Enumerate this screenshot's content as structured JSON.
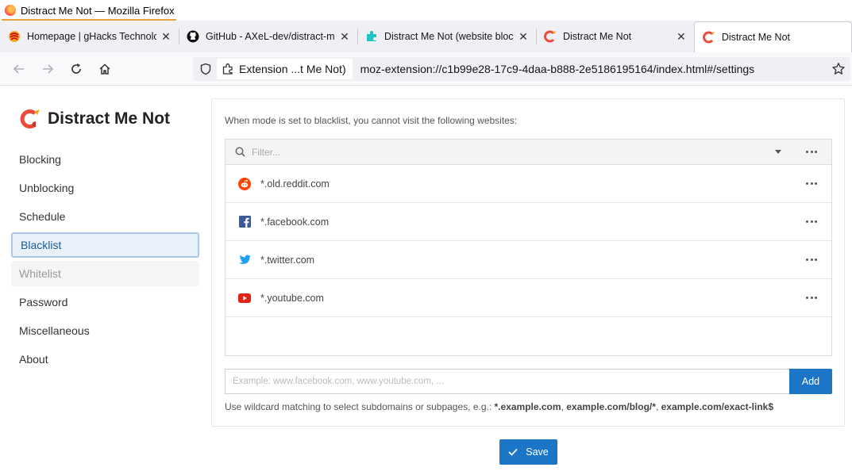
{
  "window": {
    "title": "Distract Me Not — Mozilla Firefox"
  },
  "tabs": [
    {
      "label": "Homepage | gHacks Technolog",
      "icon": "ghacks-icon",
      "active": false
    },
    {
      "label": "GitHub - AXeL-dev/distract-me",
      "icon": "github-icon",
      "active": false
    },
    {
      "label": "Distract Me Not (website blocke",
      "icon": "puzzle-icon",
      "active": false
    },
    {
      "label": "Distract Me Not",
      "icon": "magnet-icon",
      "active": false
    },
    {
      "label": "Distract Me Not",
      "icon": "magnet-icon",
      "active": true
    }
  ],
  "tab_close_glyph": "✕",
  "navbar": {
    "extension_chip": "Extension ...t Me Not)",
    "url": "moz-extension://c1b99e28-17c9-4daa-b888-2e5186195164/index.html#/settings"
  },
  "app": {
    "name": "Distract Me Not",
    "brand_color": "#e94b3c"
  },
  "sidebar": {
    "items": [
      {
        "label": "Blocking",
        "state": "normal"
      },
      {
        "label": "Unblocking",
        "state": "normal"
      },
      {
        "label": "Schedule",
        "state": "normal"
      },
      {
        "label": "Blacklist",
        "state": "active"
      },
      {
        "label": "Whitelist",
        "state": "muted"
      },
      {
        "label": "Password",
        "state": "normal"
      },
      {
        "label": "Miscellaneous",
        "state": "normal"
      },
      {
        "label": "About",
        "state": "normal"
      }
    ]
  },
  "main": {
    "description": "When mode is set to blacklist, you cannot visit the following websites:",
    "filter_placeholder": "Filter...",
    "sites": [
      {
        "pattern": "*.old.reddit.com",
        "icon": "reddit-icon",
        "color": "#ff4500"
      },
      {
        "pattern": "*.facebook.com",
        "icon": "facebook-icon",
        "color": "#3b5998"
      },
      {
        "pattern": "*.twitter.com",
        "icon": "twitter-icon",
        "color": "#1da1f2"
      },
      {
        "pattern": "*.youtube.com",
        "icon": "youtube-icon",
        "color": "#e62117"
      }
    ],
    "input_placeholder": "Example: www.facebook.com, www.youtube.com, ...",
    "add_label": "Add",
    "hint_prefix": "Use wildcard matching to select subdomains or subpages, e.g.: ",
    "hint_examples": [
      "*.example.com",
      "example.com/blog/*",
      "example.com/exact-link$"
    ],
    "hint_separator": ", "
  },
  "save_label": "Save",
  "accent_color": "#1c76c7"
}
